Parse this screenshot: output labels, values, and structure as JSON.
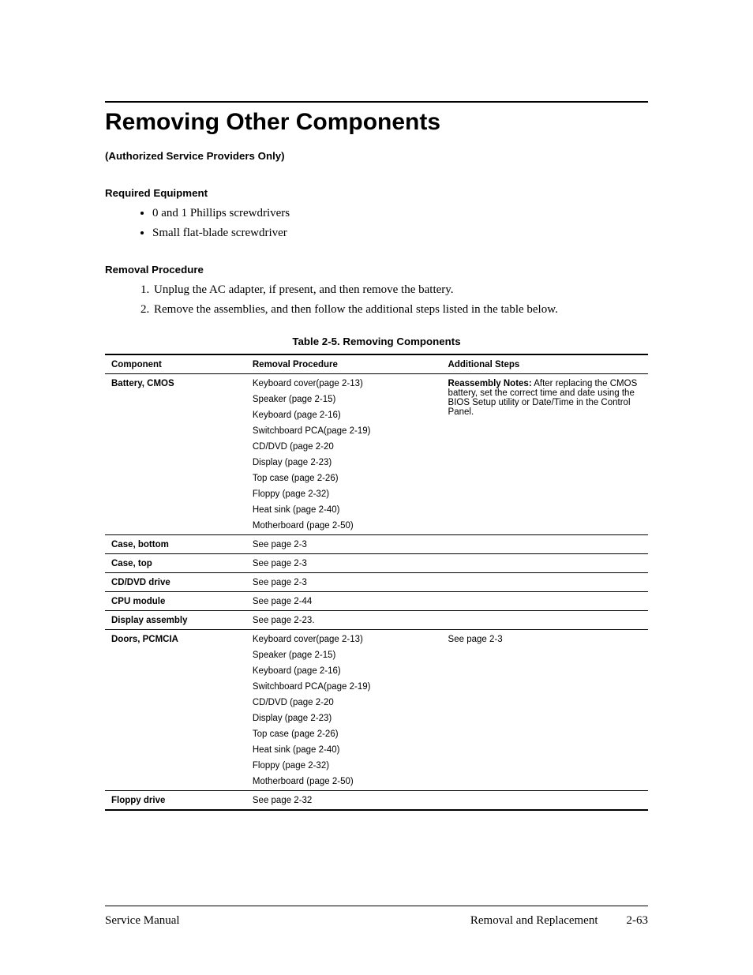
{
  "heading": "Removing Other Components",
  "subheading": "(Authorized Service Providers Only)",
  "sections": {
    "equipment_title": "Required Equipment",
    "equipment_items": [
      "0 and 1 Phillips screwdrivers",
      "Small flat-blade screwdriver"
    ],
    "procedure_title": "Removal Procedure",
    "procedure_items": [
      "Unplug the AC adapter, if present, and then remove the battery.",
      "Remove the assemblies, and then follow the additional steps listed in the table below."
    ]
  },
  "table": {
    "caption": "Table 2-5. Removing Components",
    "headers": [
      "Component",
      "Removal Procedure",
      "Additional Steps"
    ],
    "rows": [
      {
        "component": "Battery, CMOS",
        "procedure": [
          "Keyboard cover(page 2-13)",
          "Speaker (page 2-15)",
          "Keyboard (page 2-16)",
          "Switchboard PCA(page 2-19)",
          "CD/DVD (page 2-20",
          "Display (page 2-23)",
          "Top case (page 2-26)",
          "Floppy (page 2-32)",
          "Heat sink (page 2-40)",
          "Motherboard (page 2-50)"
        ],
        "additional_bold": "Reassembly Notes:",
        "additional_rest": " After replacing the CMOS battery, set the correct time and date using the BIOS Setup utility or Date/Time in the Control Panel."
      },
      {
        "component": "Case, bottom",
        "procedure": [
          "See page 2-3"
        ],
        "additional_bold": "",
        "additional_rest": ""
      },
      {
        "component": "Case, top",
        "procedure": [
          "See page 2-3"
        ],
        "additional_bold": "",
        "additional_rest": ""
      },
      {
        "component": "CD/DVD drive",
        "procedure": [
          "See page 2-3"
        ],
        "additional_bold": "",
        "additional_rest": ""
      },
      {
        "component": "CPU module",
        "procedure": [
          "See page 2-44"
        ],
        "additional_bold": "",
        "additional_rest": ""
      },
      {
        "component": "Display assembly",
        "procedure": [
          "See page 2-23."
        ],
        "additional_bold": "",
        "additional_rest": ""
      },
      {
        "component": "Doors, PCMCIA",
        "procedure": [
          "Keyboard cover(page 2-13)",
          "Speaker (page 2-15)",
          "Keyboard (page 2-16)",
          "Switchboard PCA(page 2-19)",
          "CD/DVD (page 2-20",
          "Display (page 2-23)",
          "Top case (page 2-26)",
          "Heat sink (page 2-40)",
          "Floppy (page 2-32)",
          "Motherboard (page 2-50)"
        ],
        "additional_bold": "",
        "additional_rest": "See page 2-3"
      },
      {
        "component": "Floppy drive",
        "procedure": [
          "See page 2-32"
        ],
        "additional_bold": "",
        "additional_rest": ""
      }
    ]
  },
  "footer": {
    "left": "Service Manual",
    "right_text": "Removal and Replacement",
    "right_page": "2-63"
  }
}
